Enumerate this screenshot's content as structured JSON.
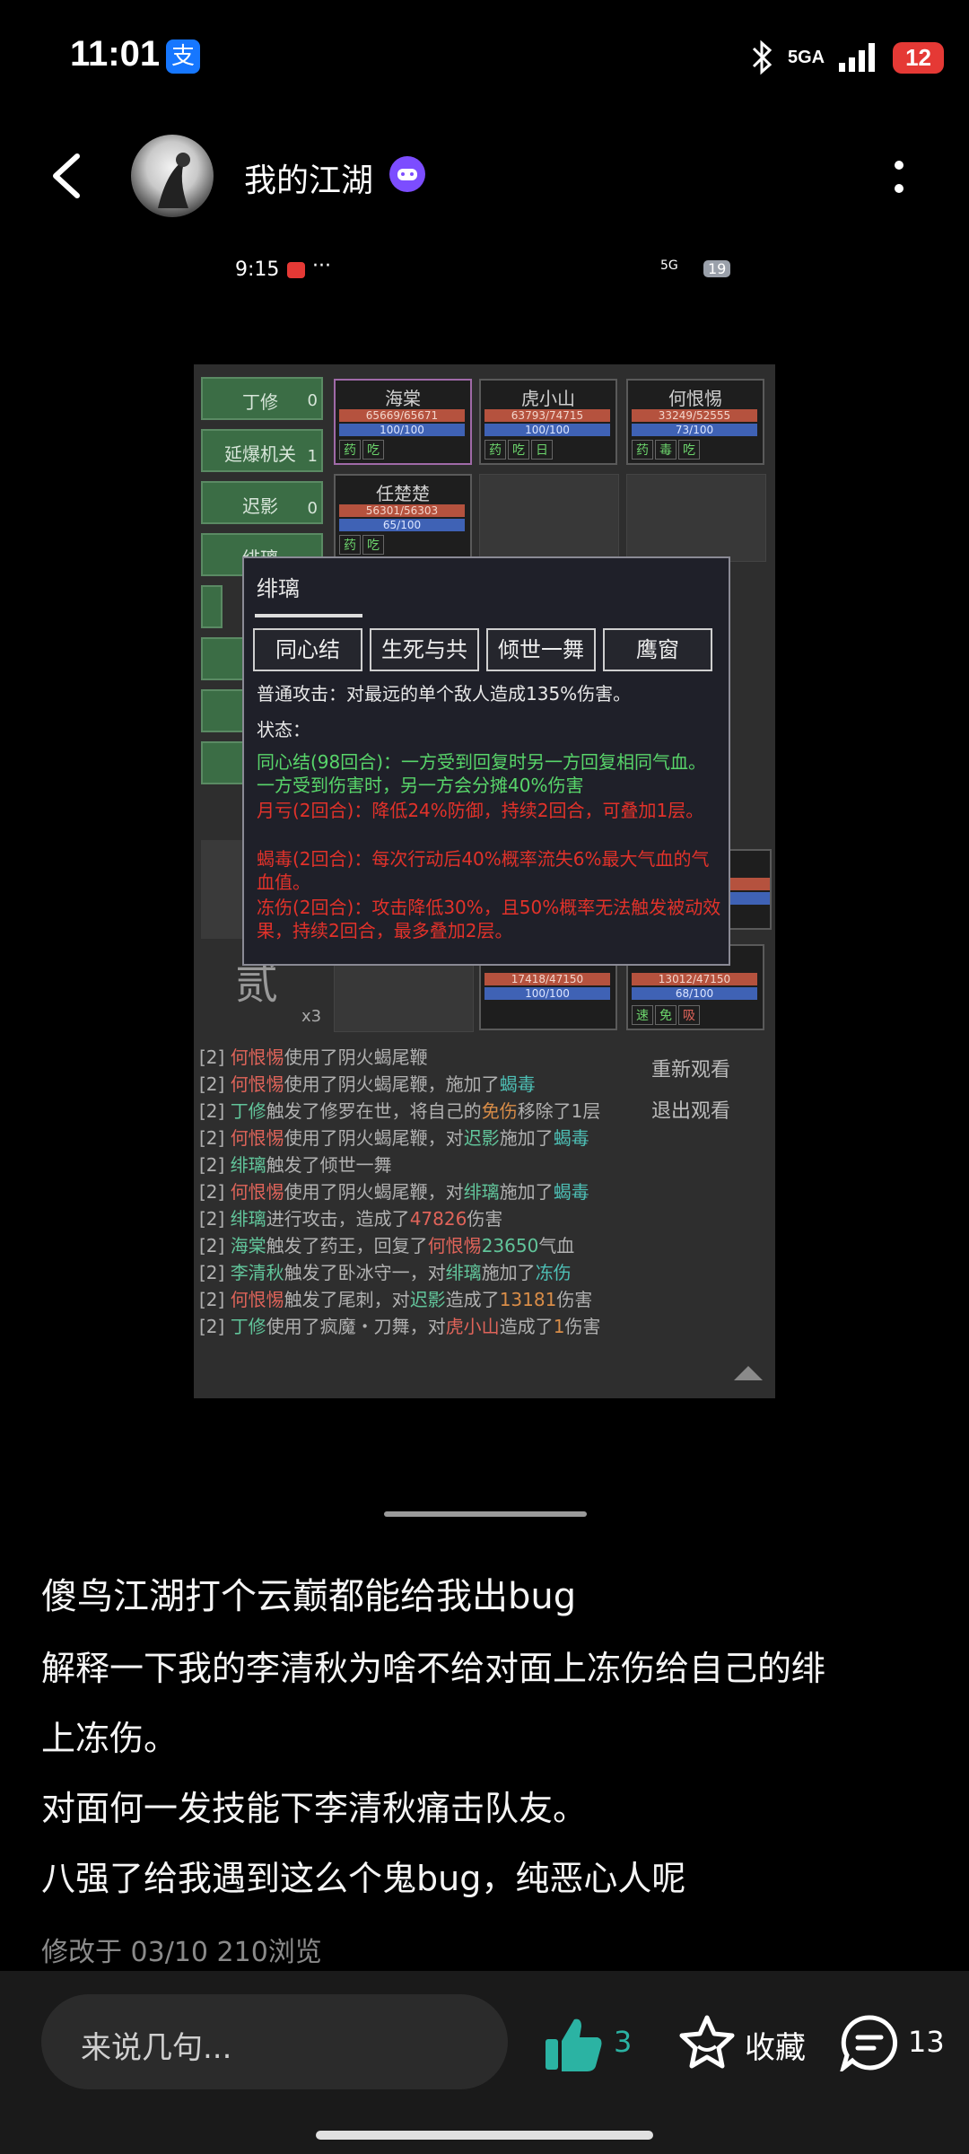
{
  "status_bar": {
    "time": "11:01",
    "alipay_glyph": "支",
    "network": "5GA",
    "battery": "12"
  },
  "header": {
    "username": "我的江湖",
    "back_icon": "chevron-left-icon",
    "more_icon": "more-vertical-icon"
  },
  "inner_status": {
    "time": "9:15",
    "dots": "···",
    "battery": "19",
    "network": "5G"
  },
  "game": {
    "side_buttons": [
      {
        "label": "丁修",
        "count": "0"
      },
      {
        "label": "延爆机关",
        "count": "1"
      },
      {
        "label": "迟影",
        "count": "0"
      },
      {
        "label": "绯璃",
        "count": ""
      }
    ],
    "cards": [
      {
        "name": "海棠",
        "hp": "65669/65671",
        "mp": "100/100",
        "tags": [
          "药",
          "吃"
        ]
      },
      {
        "name": "虎小山",
        "hp": "63793/74715",
        "mp": "100/100",
        "tags": [
          "药",
          "吃",
          "日"
        ]
      },
      {
        "name": "何恨惕",
        "hp": "33249/52555",
        "mp": "73/100",
        "tags": [
          "药",
          "毒",
          "吃"
        ]
      },
      {
        "name": "任楚楚",
        "hp": "56301/56303",
        "mp": "65/100",
        "tags": [
          "药",
          "吃"
        ]
      },
      {
        "name": "",
        "hp": "17418/47150",
        "mp": "100/100",
        "tags": []
      },
      {
        "name": "",
        "hp": "13012/47150",
        "mp": "68/100",
        "tags": [
          "速",
          "免",
          "吸"
        ]
      }
    ],
    "round_counter": "x3",
    "seal_glyph": "贰",
    "popup": {
      "title": "绯璃",
      "skills": [
        "同心结",
        "生死与共",
        "倾世一舞",
        "鹰窗"
      ],
      "basic_attack": "普通攻击：对最远的单个敌人造成135%伤害。",
      "state_label": "状态：",
      "states": [
        {
          "text": "同心结(98回合)：一方受到回复时另一方回复相同气血。一方受到伤害时，另一方会分摊40%伤害",
          "color": "#58d56a"
        },
        {
          "text": "月亏(2回合)：降低24%防御，持续2回合，可叠加1层。",
          "color": "#e2322a"
        },
        {
          "text": "蝎毒(2回合)：每次行动后40%概率流失6%最大气血的气血值。",
          "color": "#e2322a"
        },
        {
          "text": "冻伤(2回合)：攻击降低30%，且50%概率无法触发被动效果，持续2回合，最多叠加2层。",
          "color": "#e2322a"
        }
      ]
    },
    "replay_buttons": [
      "重新观看",
      "退出观看"
    ],
    "log": [
      {
        "round": "[2]",
        "parts": [
          {
            "t": "何恨惕",
            "c": "red"
          },
          {
            "t": "使用了阴火蝎尾鞭",
            "c": ""
          }
        ]
      },
      {
        "round": "[2]",
        "parts": [
          {
            "t": "何恨惕",
            "c": "red"
          },
          {
            "t": "使用了阴火蝎尾鞭，施加了",
            "c": ""
          },
          {
            "t": "蝎毒",
            "c": "cyan"
          }
        ]
      },
      {
        "round": "[2]",
        "parts": [
          {
            "t": "丁修",
            "c": "green"
          },
          {
            "t": "触发了修罗在世，将自己的",
            "c": ""
          },
          {
            "t": "免伤",
            "c": "orange"
          },
          {
            "t": "移除了1层",
            "c": ""
          }
        ]
      },
      {
        "round": "[2]",
        "parts": [
          {
            "t": "何恨惕",
            "c": "red"
          },
          {
            "t": "使用了阴火蝎尾鞭，对",
            "c": ""
          },
          {
            "t": "迟影",
            "c": "green"
          },
          {
            "t": "施加了",
            "c": ""
          },
          {
            "t": "蝎毒",
            "c": "cyan"
          }
        ]
      },
      {
        "round": "[2]",
        "parts": [
          {
            "t": "绯璃",
            "c": "green"
          },
          {
            "t": "触发了倾世一舞",
            "c": ""
          }
        ]
      },
      {
        "round": "[2]",
        "parts": [
          {
            "t": "何恨惕",
            "c": "red"
          },
          {
            "t": "使用了阴火蝎尾鞭，对",
            "c": ""
          },
          {
            "t": "绯璃",
            "c": "green"
          },
          {
            "t": "施加了",
            "c": ""
          },
          {
            "t": "蝎毒",
            "c": "cyan"
          }
        ]
      },
      {
        "round": "[2]",
        "parts": [
          {
            "t": "绯璃",
            "c": "green"
          },
          {
            "t": "进行攻击，造成了",
            "c": ""
          },
          {
            "t": "47826",
            "c": "red"
          },
          {
            "t": "伤害",
            "c": ""
          }
        ]
      },
      {
        "round": "[2]",
        "parts": [
          {
            "t": "海棠",
            "c": "green"
          },
          {
            "t": "触发了药王，回复了",
            "c": ""
          },
          {
            "t": "何恨惕",
            "c": "red"
          },
          {
            "t": "23650",
            "c": "green"
          },
          {
            "t": "气血",
            "c": ""
          }
        ]
      },
      {
        "round": "[2]",
        "parts": [
          {
            "t": "李清秋",
            "c": "green"
          },
          {
            "t": "触发了卧冰守一，对",
            "c": ""
          },
          {
            "t": "绯璃",
            "c": "green"
          },
          {
            "t": "施加了",
            "c": ""
          },
          {
            "t": "冻伤",
            "c": "cyan"
          }
        ]
      },
      {
        "round": "[2]",
        "parts": [
          {
            "t": "何恨惕",
            "c": "red"
          },
          {
            "t": "触发了尾刺，对",
            "c": ""
          },
          {
            "t": "迟影",
            "c": "green"
          },
          {
            "t": "造成了",
            "c": ""
          },
          {
            "t": "13181",
            "c": "orange"
          },
          {
            "t": "伤害",
            "c": ""
          }
        ]
      },
      {
        "round": "[2]",
        "parts": [
          {
            "t": "丁修",
            "c": "green"
          },
          {
            "t": "使用了疯魔・刀舞，对",
            "c": ""
          },
          {
            "t": "虎小山",
            "c": "red"
          },
          {
            "t": "造成了",
            "c": ""
          },
          {
            "t": "1",
            "c": "orange"
          },
          {
            "t": "伤害",
            "c": ""
          }
        ]
      }
    ]
  },
  "post": {
    "lines": [
      "傻鸟江湖打个云巅都能给我出bug",
      "解释一下我的李清秋为啥不给对面上冻伤给自己的绯",
      "上冻伤。",
      "对面何一发技能下李清秋痛击队友。",
      "八强了给我遇到这么个鬼bug，纯恶心人呢"
    ],
    "meta": "修改于 03/10  210浏览"
  },
  "bottom": {
    "input_placeholder": "来说几句...",
    "like_count": "3",
    "favorite_label": "收藏",
    "comment_count": "13"
  }
}
